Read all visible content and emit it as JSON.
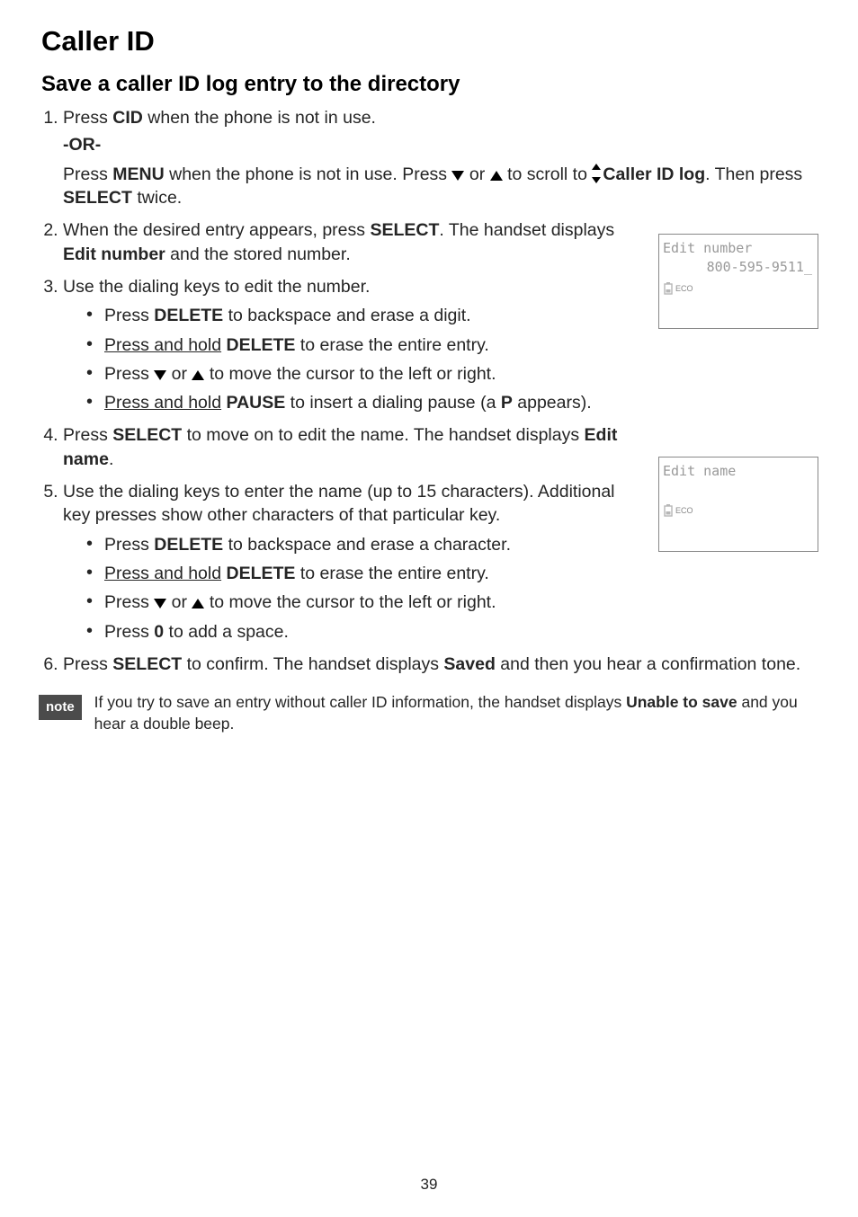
{
  "title": "Caller ID",
  "subtitle": "Save a caller ID log entry to the directory",
  "step1_a": "Press ",
  "step1_b": "CID",
  "step1_c": " when the phone is not in use.",
  "or": "-OR-",
  "step1_alt_a": "Press ",
  "step1_alt_b": "MENU",
  "step1_alt_c": " when the phone is not in use. Press ",
  "step1_alt_d": " or ",
  "step1_alt_e": " to scroll to ",
  "step1_alt_f": "Caller ID log",
  "step1_alt_g": ". Then press ",
  "step1_alt_h": "SELECT",
  "step1_alt_i": " twice.",
  "step2_a": "When the desired entry appears, press ",
  "step2_b": "SELECT",
  "step2_c": ". The handset displays ",
  "step2_d": "Edit number",
  "step2_e": " and the stored number.",
  "step3": "Use the dialing keys to edit the number.",
  "b3_1a": "Press ",
  "b3_1b": "DELETE",
  "b3_1c": " to backspace and erase a digit.",
  "b3_2a": "Press and hold",
  "b3_2b": "DELETE",
  "b3_2c": " to erase the entire entry.",
  "b3_3a": "Press ",
  "b3_3b": " or ",
  "b3_3c": " to move the cursor to the left or right.",
  "b3_4a": "Press and hold",
  "b3_4b": "PAUSE",
  "b3_4c": " to insert a dialing pause (a ",
  "b3_4d": "P",
  "b3_4e": " appears).",
  "step4_a": "Press ",
  "step4_b": "SELECT",
  "step4_c": " to move on to edit the name. The handset displays ",
  "step4_d": "Edit name",
  "step4_e": ".",
  "step5": "Use the dialing keys to enter the name (up to 15 characters). Additional key presses show other characters of that particular key.",
  "b5_1a": "Press ",
  "b5_1b": "DELETE",
  "b5_1c": " to backspace and erase a character.",
  "b5_2a": "Press and hold",
  "b5_2b": "DELETE",
  "b5_2c": " to erase the entire entry.",
  "b5_3a": "Press ",
  "b5_3b": " or ",
  "b5_3c": " to move the cursor to the left or right.",
  "b5_4a": "Press ",
  "b5_4b": "0",
  "b5_4c": " to add a space.",
  "step6_a": "Press ",
  "step6_b": "SELECT",
  "step6_c": " to confirm. The handset displays ",
  "step6_d": "Saved",
  "step6_e": " and then you hear a confirmation tone.",
  "note_label": "note",
  "note_a": "If you try to save an entry without caller ID information, the handset displays ",
  "note_b": "Unable to save",
  "note_c": " and you hear a double beep.",
  "screen1_l1": "Edit number",
  "screen1_l2": "800-595-9511_",
  "screen2_l1": "Edit name",
  "eco": "ECO",
  "pagenum": "39"
}
